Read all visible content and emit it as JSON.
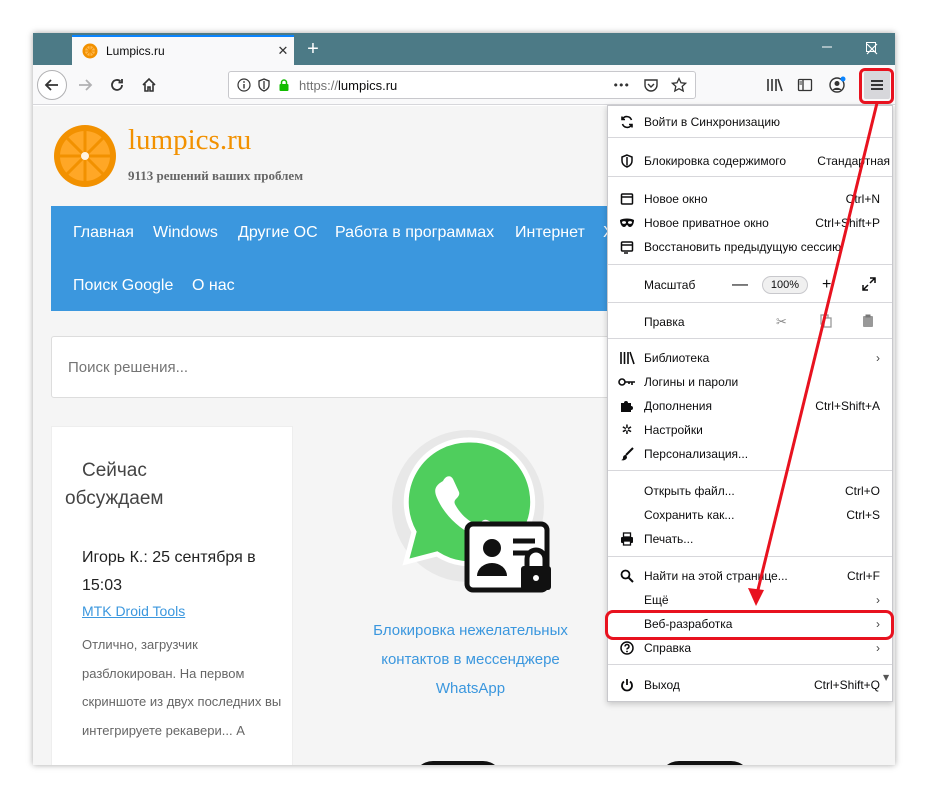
{
  "tab": {
    "title": "Lumpics.ru",
    "close": "✕",
    "new": "+"
  },
  "window_controls": {
    "minimize": "—",
    "maximize": "☐",
    "close": "✕"
  },
  "url": {
    "protocol": "https://",
    "host": "lumpics.ru",
    "more": "•••"
  },
  "site": {
    "name": "lumpics.ru",
    "subtitle": "9113 решений ваших проблем",
    "nav": [
      "Главная",
      "Windows",
      "Другие ОС",
      "Работа в программах",
      "Интернет",
      "Х",
      "Поиск Google",
      "О нас"
    ],
    "search_placeholder": "Поиск решения...",
    "sidebar": {
      "title_line1": "Сейчас",
      "title_line2": "обсуждаем",
      "author": "Игорь К.: 25 сентября в 15:03",
      "link": "MTK Droid Tools",
      "text": "Отлично, загрузчик разблокирован. На первом скриншоте из двух последних вы интегрируете рекавери... А"
    },
    "article_title": "Блокировка нежелательных контактов в мессенджере WhatsApp"
  },
  "menu": {
    "sync": "Войти в Синхронизацию",
    "blocking": "Блокировка содержимого",
    "blocking_mode": "Стандартная",
    "new_window": "Новое окно",
    "new_window_sc": "Ctrl+N",
    "private_window": "Новое приватное окно",
    "private_window_sc": "Ctrl+Shift+P",
    "restore_session": "Восстановить предыдущую сессию",
    "zoom_label": "Масштаб",
    "zoom_minus": "—",
    "zoom_value": "100%",
    "zoom_plus": "+",
    "edit_label": "Правка",
    "library": "Библиотека",
    "logins": "Логины и пароли",
    "addons": "Дополнения",
    "addons_sc": "Ctrl+Shift+A",
    "settings": "Настройки",
    "personalization": "Персонализация...",
    "open_file": "Открыть файл...",
    "open_file_sc": "Ctrl+O",
    "save_as": "Сохранить как...",
    "save_as_sc": "Ctrl+S",
    "print": "Печать...",
    "find": "Найти на этой странице...",
    "find_sc": "Ctrl+F",
    "more": "Ещё",
    "webdev": "Веб-разработка",
    "help": "Справка",
    "exit": "Выход",
    "exit_sc": "Ctrl+Shift+Q",
    "arrow": "›"
  },
  "colors": {
    "highlight": "#e8121f",
    "accent_blue": "#3b97de",
    "logo_orange": "#f29100",
    "tabstrip": "#4c7a86"
  }
}
